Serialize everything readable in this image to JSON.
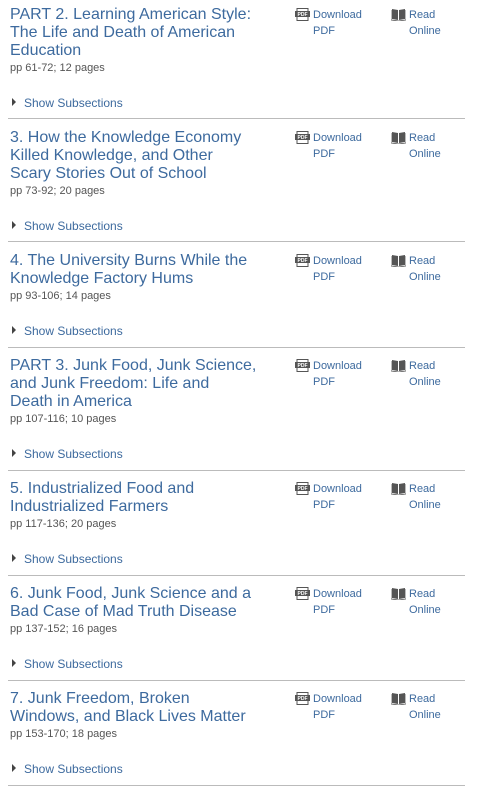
{
  "labels": {
    "download_line1": "Download",
    "download_line2": "PDF",
    "read_line1": "Read",
    "read_line2": "Online",
    "show_subsections": "Show Subsections"
  },
  "icons": {
    "pdf": "pdf-icon",
    "read": "book-icon",
    "expand": "caret-right-icon"
  },
  "colors": {
    "link": "#3d6a9e",
    "divider": "#bbbbbb"
  },
  "chapters": [
    {
      "title_lines": [
        "PART 2. Learning American Style:",
        "The Life and Death of American",
        "Education"
      ],
      "pages": "pp 61-72; 12 pages"
    },
    {
      "title_lines": [
        "3. How the Knowledge Economy",
        "Killed Knowledge, and Other",
        "Scary Stories Out of School"
      ],
      "pages": "pp 73-92; 20 pages"
    },
    {
      "title_lines": [
        "4. The University Burns While the",
        "Knowledge Factory Hums"
      ],
      "pages": "pp 93-106; 14 pages"
    },
    {
      "title_lines": [
        "PART 3. Junk Food, Junk Science,",
        "and Junk Freedom: Life and",
        "Death in America"
      ],
      "pages": "pp 107-116; 10 pages"
    },
    {
      "title_lines": [
        "5. Industrialized Food and",
        "Industrialized Farmers"
      ],
      "pages": "pp 117-136; 20 pages"
    },
    {
      "title_lines": [
        "6. Junk Food, Junk Science and a",
        "Bad Case of Mad Truth Disease"
      ],
      "pages": "pp 137-152; 16 pages"
    },
    {
      "title_lines": [
        "7. Junk Freedom, Broken",
        "Windows, and Black Lives Matter"
      ],
      "pages": "pp 153-170; 18 pages"
    }
  ]
}
